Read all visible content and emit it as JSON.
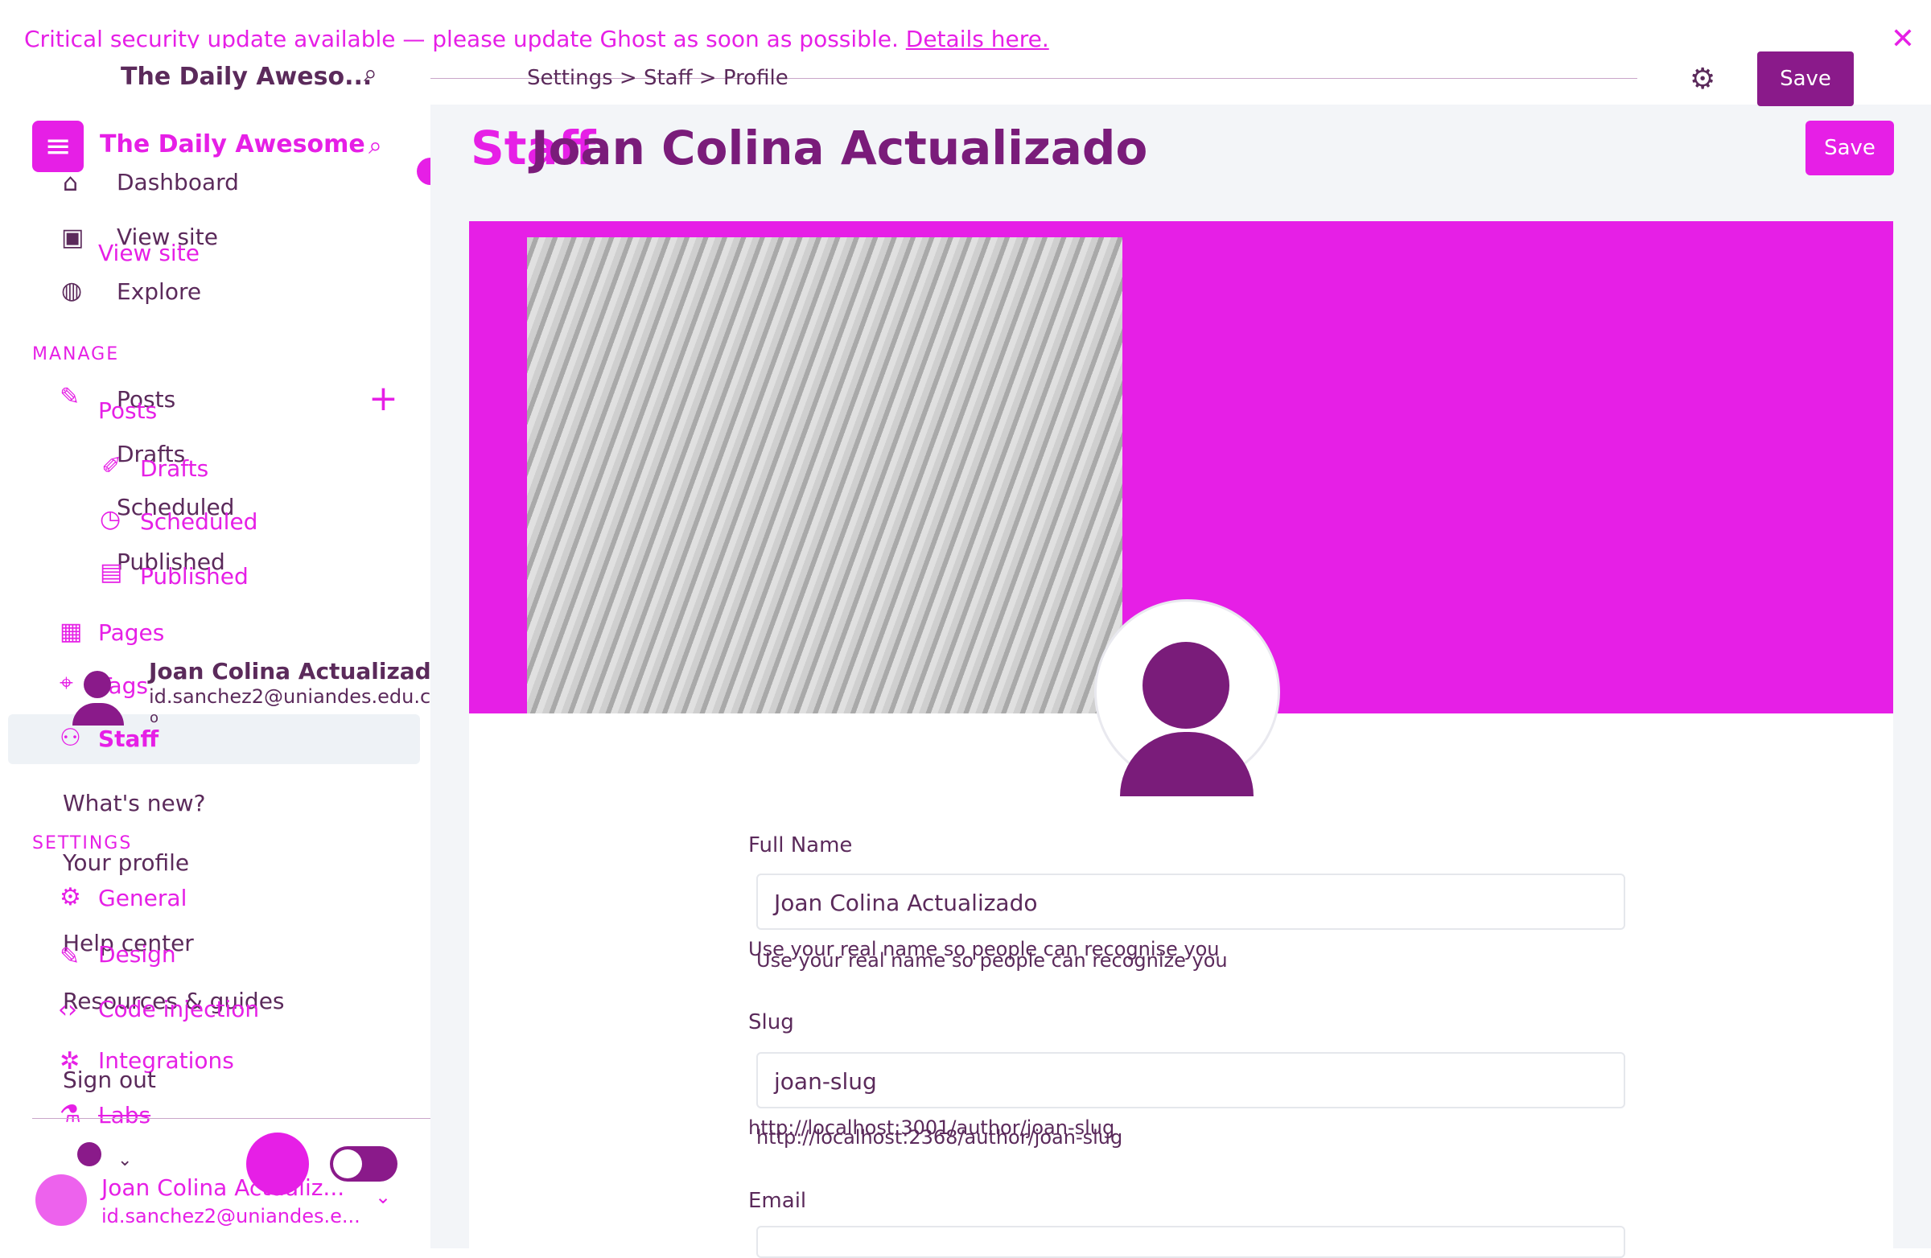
{
  "banner": {
    "text": "Critical security update available — please update Ghost as soon as possible.",
    "link": "Details here."
  },
  "brand": {
    "site_title": "The Daily Aweso...",
    "site_title_full": "The Daily Awesome"
  },
  "sidebar": {
    "top_items": [
      {
        "label": "Dashboard",
        "icon": "home-icon"
      },
      {
        "label": "View site",
        "icon": "browser-icon"
      },
      {
        "label": "View site",
        "icon": "browser-icon"
      },
      {
        "label": "Explore",
        "icon": "globe-icon"
      }
    ],
    "manage_label": "MANAGE",
    "manage_items": [
      {
        "label": "Posts"
      },
      {
        "label": "Posts"
      },
      {
        "label": "Drafts"
      },
      {
        "label": "Drafts"
      },
      {
        "label": "Scheduled"
      },
      {
        "label": "Scheduled"
      },
      {
        "label": "Published"
      },
      {
        "label": "Published"
      },
      {
        "label": "Pages"
      },
      {
        "label": "Tags"
      },
      {
        "label": "Staff"
      }
    ],
    "account_menu": [
      "What's new?",
      "Your profile",
      "Help center",
      "Resources & guides",
      "Sign out"
    ],
    "settings_label": "SETTINGS",
    "settings_items": [
      "General",
      "Design",
      "Code injection",
      "Integrations",
      "Labs"
    ]
  },
  "popover": {
    "name": "Joan Colina Actualizado",
    "email": "id.sanchez2@uniandes.edu.c",
    "suffix": "o"
  },
  "user": {
    "name": "Joan Colina Actualiz...",
    "email": "id.sanchez2@uniandes.e..."
  },
  "breadcrumb": [
    "Settings",
    ">",
    "Staff",
    ">",
    "Profile"
  ],
  "header": {
    "title_overlay": "Staff",
    "title": "Joan Colina Actualizado",
    "save": "Save",
    "save_top": "Save"
  },
  "form": {
    "full_name_label": "Full Name",
    "full_name_value": "Joan Colina Actualizado",
    "full_name_help": "Use your real name so people can recognise you",
    "full_name_help_alt": "Use your real name so people can recognize you",
    "slug_label": "Slug",
    "slug_value": "joan-slug",
    "slug_help": "http://localhost:3001/author/joan-slug",
    "slug_help_alt": "http://localhost:2368/author/joan-slug",
    "email_label": "Email"
  },
  "colors": {
    "accent": "#e61fe6",
    "dark": "#5b2a5b",
    "deep": "#8a1a8a"
  }
}
